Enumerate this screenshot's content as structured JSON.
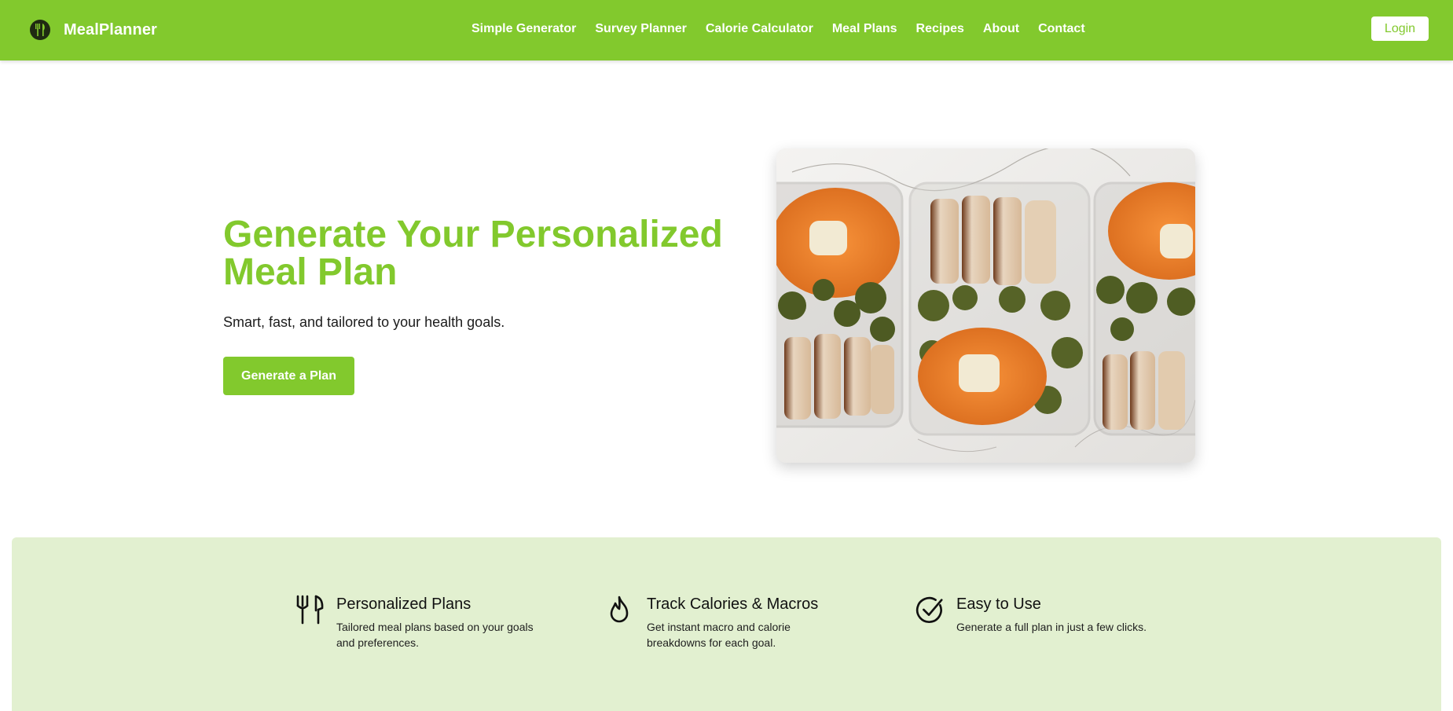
{
  "brand": {
    "name": "MealPlanner",
    "logo_icon": "utensils-circle-icon"
  },
  "nav": {
    "links": [
      {
        "label": "Simple Generator"
      },
      {
        "label": "Survey Planner"
      },
      {
        "label": "Calorie Calculator"
      },
      {
        "label": "Meal Plans"
      },
      {
        "label": "Recipes"
      },
      {
        "label": "About"
      },
      {
        "label": "Contact"
      }
    ],
    "login_label": "Login"
  },
  "hero": {
    "title": "Generate Your Personalized Meal Plan",
    "subtitle": "Smart, fast, and tailored to your health goals.",
    "cta_label": "Generate a Plan"
  },
  "features": [
    {
      "icon": "utensils-icon",
      "title": "Personalized Plans",
      "description": "Tailored meal plans based on your goals and preferences."
    },
    {
      "icon": "flame-icon",
      "title": "Track Calories & Macros",
      "description": "Get instant macro and calorie breakdowns for each goal."
    },
    {
      "icon": "check-circle-icon",
      "title": "Easy to Use",
      "description": "Generate a full plan in just a few clicks."
    }
  ],
  "colors": {
    "brand_green": "#82c92d",
    "features_background": "#e2f0d0",
    "text_dark": "#212529",
    "white": "#ffffff"
  }
}
